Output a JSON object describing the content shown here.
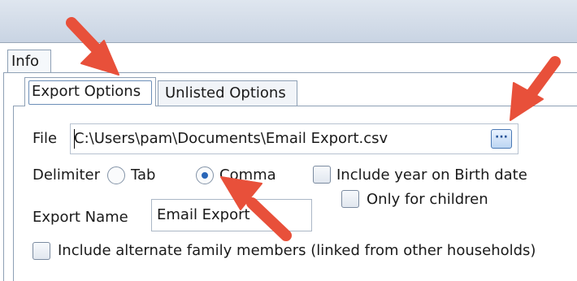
{
  "window": {
    "tab": "Info"
  },
  "tabs": [
    {
      "label": "Export Options",
      "active": true
    },
    {
      "label": "Unlisted Options",
      "active": false
    }
  ],
  "form": {
    "file_label": "File",
    "file_value": "C:\\Users\\pam\\Documents\\Email Export.csv",
    "browse_label": "···",
    "delimiter_label": "Delimiter",
    "delimiter_options": [
      {
        "label": "Tab",
        "checked": false
      },
      {
        "label": "Comma",
        "checked": true
      }
    ],
    "include_year_label": "Include year on Birth date",
    "include_year_checked": false,
    "only_children_label": "Only for children",
    "only_children_checked": false,
    "export_name_label": "Export Name",
    "export_name_value": "Email Export",
    "include_alternate_label": "Include alternate family members (linked from other households)",
    "include_alternate_checked": false
  },
  "colors": {
    "annotation_arrow": "#e8503a",
    "accent": "#2a66b8"
  }
}
